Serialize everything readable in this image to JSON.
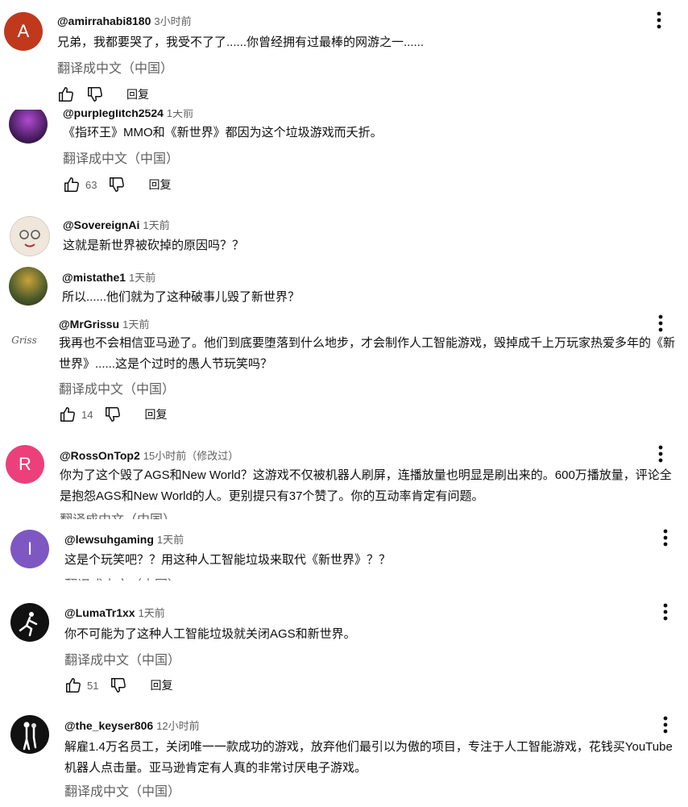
{
  "common": {
    "translate_label": "翻译成中文（中国）",
    "reply_label": "回复"
  },
  "comments": [
    {
      "avatar_letter": "A",
      "avatar_color": "#c0391d",
      "author": "@amirrahabi8180",
      "time": "3小时前",
      "text": "兄弟，我都要哭了，我受不了了......你曾经拥有过最棒的网游之一......",
      "likes": ""
    },
    {
      "avatar_letter": "",
      "avatar_color": "#3a1850",
      "author": "@purpleglitch2524",
      "time": "1天前",
      "text": "《指环王》MMO和《新世界》都因为这个垃圾游戏而夭折。",
      "likes": "63"
    },
    {
      "avatar_letter": "",
      "avatar_color": "#e8dcd0",
      "author": "@SovereignAi",
      "time": "1天前",
      "text": "这就是新世界被砍掉的原因吗？？",
      "likes": ""
    },
    {
      "avatar_letter": "",
      "avatar_color": "#6b5a2a",
      "author": "@mistathe1",
      "time": "1天前",
      "text": "所以......他们就为了这种破事儿毁了新世界？",
      "likes": ""
    },
    {
      "avatar_letter": "Griss",
      "avatar_color": "#ffffff",
      "author": "@MrGrissu",
      "time": "1天前",
      "text": "我再也不会相信亚马逊了。他们到底要堕落到什么地步，才会制作人工智能游戏，毁掉成千上万玩家热爱多年的《新世界》......这是个过时的愚人节玩笑吗？",
      "likes": "14"
    },
    {
      "avatar_letter": "R",
      "avatar_color": "#ec407a",
      "author": "@RossOnTop2",
      "time": "15小时前（修改过）",
      "text": "你为了这个毁了AGS和New World？这游戏不仅被机器人刷屏，连播放量也明显是刷出来的。600万播放量，评论全是抱怨AGS和New World的人。更别提只有37个赞了。你的互动率肯定有问题。",
      "likes": ""
    },
    {
      "avatar_letter": "I",
      "avatar_color": "#7e57c2",
      "author": "@lewsuhgaming",
      "time": "1天前",
      "text": "这是个玩笑吧？？用这种人工智能垃圾来取代《新世界》？？",
      "likes": ""
    },
    {
      "avatar_letter": "",
      "avatar_color": "#111111",
      "author": "@LumaTr1xx",
      "time": "1天前",
      "text": "你不可能为了这种人工智能垃圾就关闭AGS和新世界。",
      "likes": "51"
    },
    {
      "avatar_letter": "",
      "avatar_color": "#111111",
      "author": "@the_keyser806",
      "time": "12小时前",
      "text": "解雇1.4万名员工，关闭唯一一款成功的游戏，放弃他们最引以为傲的项目，专注于人工智能游戏，花钱买YouTube机器人点击量。亚马逊肯定有人真的非常讨厌电子游戏。",
      "likes": ""
    }
  ]
}
